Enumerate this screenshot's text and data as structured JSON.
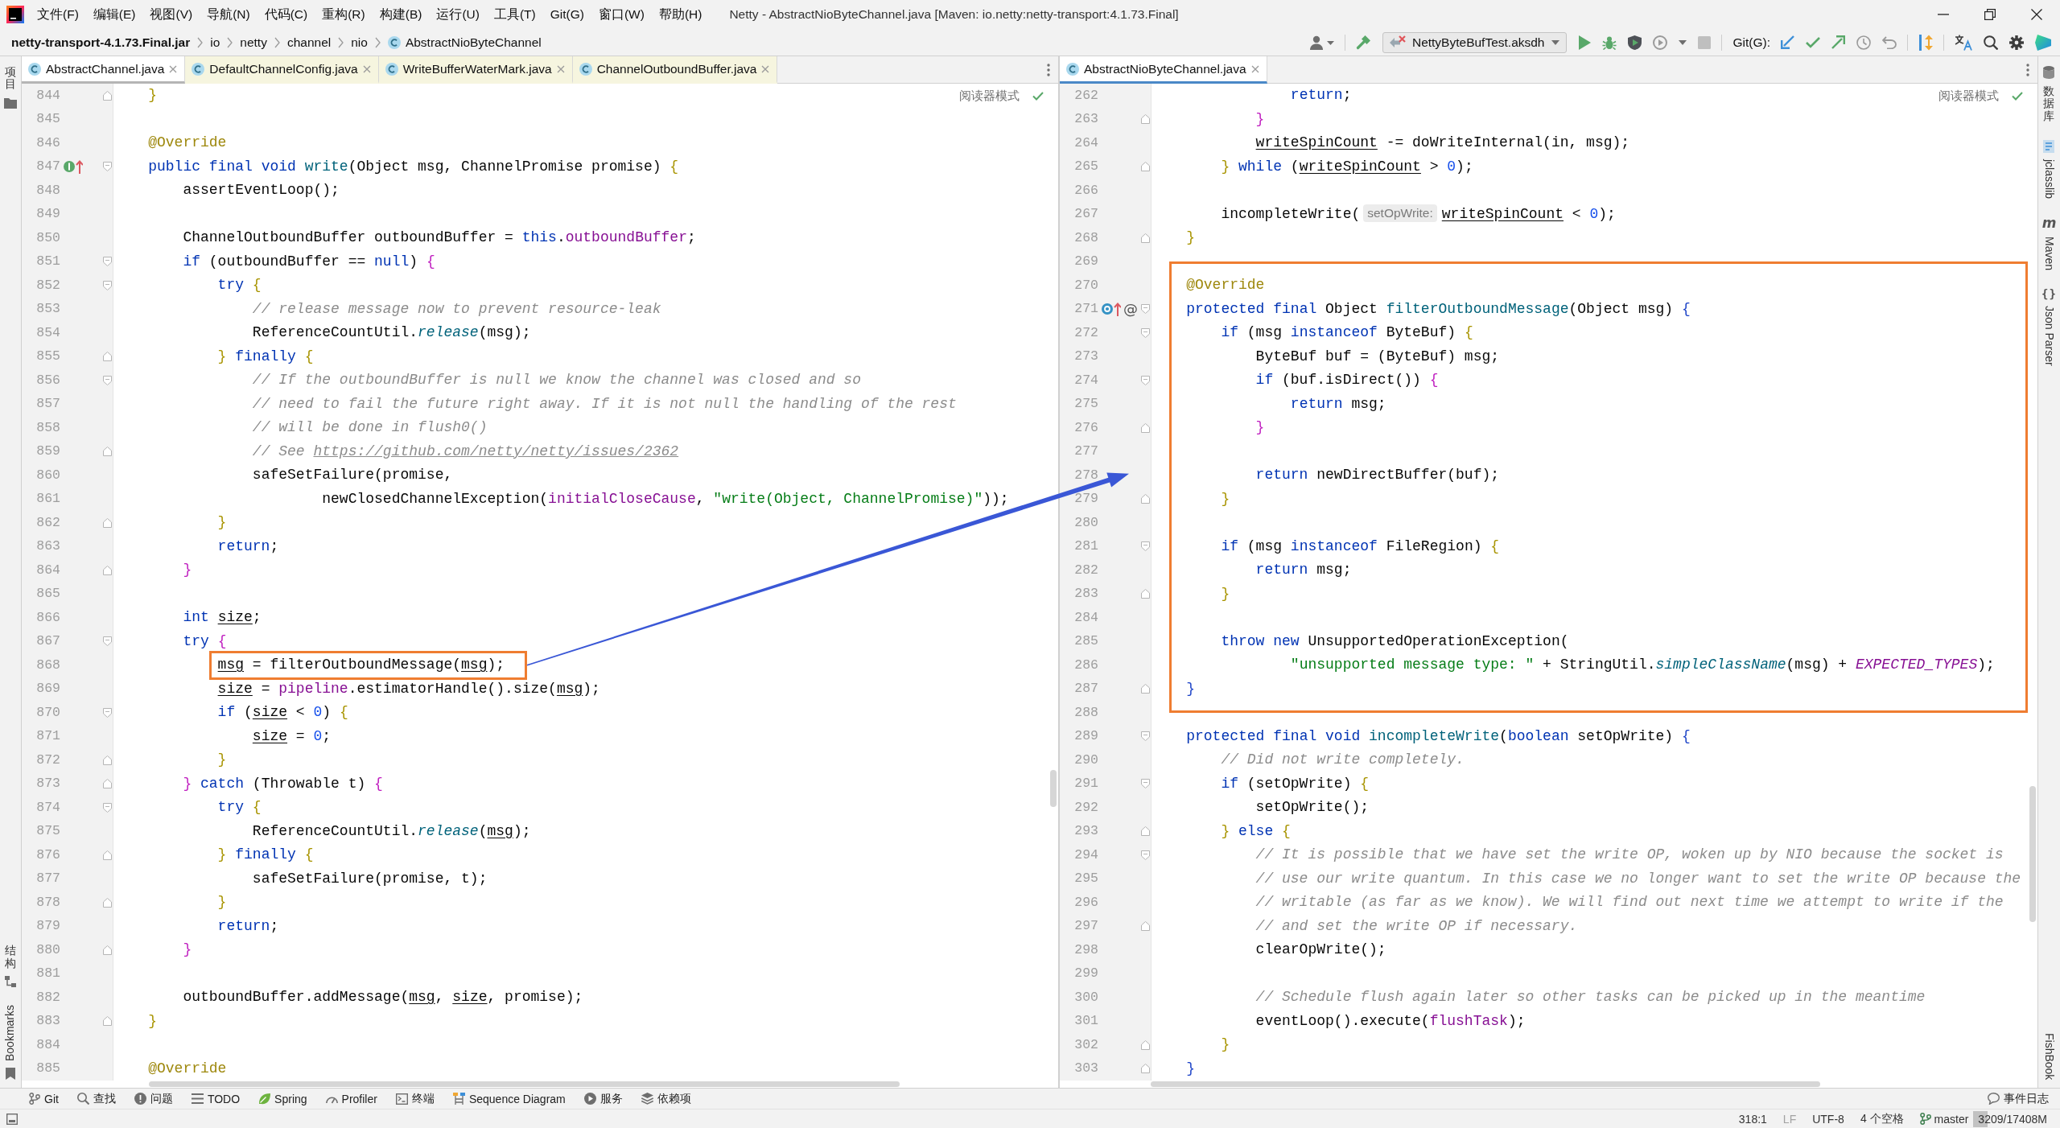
{
  "window": {
    "title": "Netty - AbstractNioByteChannel.java [Maven: io.netty:netty-transport:4.1.73.Final]"
  },
  "menu": [
    "文件(F)",
    "编辑(E)",
    "视图(V)",
    "导航(N)",
    "代码(C)",
    "重构(R)",
    "构建(B)",
    "运行(U)",
    "工具(T)",
    "Git(G)",
    "窗口(W)",
    "帮助(H)"
  ],
  "breadcrumbs": [
    {
      "label": "netty-transport-4.1.73.Final.jar",
      "kind": "archive"
    },
    {
      "label": "io",
      "kind": "package"
    },
    {
      "label": "netty",
      "kind": "package"
    },
    {
      "label": "channel",
      "kind": "package"
    },
    {
      "label": "nio",
      "kind": "package"
    },
    {
      "label": "AbstractNioByteChannel",
      "kind": "class"
    }
  ],
  "toolbar": [
    {
      "kind": "user",
      "disabled": false
    },
    {
      "kind": "build",
      "disabled": false
    },
    {
      "kind": "run-config",
      "label": "NettyByteBufTest.aksdh",
      "disabled": false
    },
    {
      "kind": "run",
      "disabled": false
    },
    {
      "kind": "debug",
      "disabled": false
    },
    {
      "kind": "coverage",
      "disabled": false
    },
    {
      "kind": "profile",
      "disabled": false
    },
    {
      "kind": "more",
      "disabled": false
    },
    {
      "kind": "stop",
      "disabled": true
    },
    {
      "kind": "label",
      "label": "Git(G):"
    },
    {
      "kind": "update",
      "disabled": false
    },
    {
      "kind": "commit",
      "disabled": false
    },
    {
      "kind": "push",
      "disabled": false
    },
    {
      "kind": "history",
      "disabled": false
    },
    {
      "kind": "rollback",
      "disabled": false
    },
    {
      "kind": "vcs",
      "disabled": false
    },
    {
      "kind": "translate",
      "disabled": false
    },
    {
      "kind": "search",
      "disabled": false
    },
    {
      "kind": "settings",
      "disabled": false
    },
    {
      "kind": "toolbox",
      "disabled": false
    }
  ],
  "left_strip": {
    "top": [
      {
        "label": "项目",
        "kind": "project"
      }
    ],
    "bottom": [
      {
        "label": "结构",
        "kind": "structure"
      },
      {
        "label": "Bookmarks",
        "kind": "bookmarks"
      }
    ]
  },
  "editors": [
    {
      "focused": false,
      "reader_mode": "阅读器模式",
      "tabs": [
        {
          "label": "AbstractChannel.java",
          "selected": true
        },
        {
          "label": "DefaultChannelConfig.java",
          "selected": false
        },
        {
          "label": "WriteBufferWaterMark.java",
          "selected": false
        },
        {
          "label": "ChannelOutboundBuffer.java",
          "selected": false
        }
      ],
      "blocks": [
        {
          "highlighted": false,
          "lines": [
            {
              "number": "844",
              "fold": {
                "kind": "end"
              },
              "code": [
                {
                  "text": "    }",
                  "kind": "b1"
                }
              ]
            },
            {
              "number": "845"
            },
            {
              "number": "846",
              "code": [
                {
                  "text": "    @Override",
                  "kind": "ann"
                }
              ]
            },
            {
              "number": "847",
              "fold": {
                "kind": "start"
              },
              "gutter": [
                {
                  "kind": "implements"
                }
              ],
              "code": [
                {
                  "text": "    public final void ",
                  "kind": "kw"
                },
                {
                  "text": "write",
                  "kind": "fn"
                },
                {
                  "text": "(Object msg, ChannelPromise promise) ",
                  "kind": "p"
                },
                {
                  "text": "{",
                  "kind": "b1"
                }
              ]
            },
            {
              "number": "848",
              "code": [
                {
                  "text": "        assertEventLoop();",
                  "kind": "p"
                }
              ]
            },
            {
              "number": "849"
            },
            {
              "number": "850",
              "code": [
                {
                  "text": "        ChannelOutboundBuffer outboundBuffer = ",
                  "kind": "p"
                },
                {
                  "text": "this",
                  "kind": "kw"
                },
                {
                  "text": ".",
                  "kind": "p"
                },
                {
                  "text": "outboundBuffer",
                  "kind": "field"
                },
                {
                  "text": ";",
                  "kind": "p"
                }
              ]
            },
            {
              "number": "851",
              "fold": {
                "kind": "start"
              },
              "code": [
                {
                  "text": "        if ",
                  "kind": "kw"
                },
                {
                  "text": "(outboundBuffer == ",
                  "kind": "p"
                },
                {
                  "text": "null",
                  "kind": "kw"
                },
                {
                  "text": ") ",
                  "kind": "p"
                },
                {
                  "text": "{",
                  "kind": "b2"
                }
              ]
            },
            {
              "number": "852",
              "fold": {
                "kind": "start"
              },
              "code": [
                {
                  "text": "            try ",
                  "kind": "kw"
                },
                {
                  "text": "{",
                  "kind": "b1"
                }
              ]
            },
            {
              "number": "853",
              "code": [
                {
                  "text": "                // release message now to prevent resource-leak",
                  "kind": "com"
                }
              ]
            },
            {
              "number": "854",
              "code": [
                {
                  "text": "                ReferenceCountUtil.",
                  "kind": "p"
                },
                {
                  "text": "release",
                  "kind": "static"
                },
                {
                  "text": "(msg);",
                  "kind": "p"
                }
              ]
            },
            {
              "number": "855",
              "fold": {
                "kind": "end"
              },
              "code": [
                {
                  "text": "            }",
                  "kind": "b1"
                },
                {
                  "text": " finally ",
                  "kind": "kw"
                },
                {
                  "text": "{",
                  "kind": "b1"
                }
              ]
            },
            {
              "number": "856",
              "fold": {
                "kind": "start"
              },
              "code": [
                {
                  "text": "                // If the outboundBuffer is null we know the channel was closed and so",
                  "kind": "com"
                }
              ]
            },
            {
              "number": "857",
              "code": [
                {
                  "text": "                // need to fail the future right away. If it is not null the handling of the rest",
                  "kind": "com"
                }
              ]
            },
            {
              "number": "858",
              "code": [
                {
                  "text": "                // will be done in flush0()",
                  "kind": "com"
                }
              ]
            },
            {
              "number": "859",
              "fold": {
                "kind": "end"
              },
              "code": [
                {
                  "text": "                // See ",
                  "kind": "com"
                },
                {
                  "text": "https://github.com/netty/netty/issues/2362",
                  "kind": "link"
                }
              ]
            },
            {
              "number": "860",
              "code": [
                {
                  "text": "                safeSetFailure(promise,",
                  "kind": "p"
                }
              ]
            },
            {
              "number": "861",
              "code": [
                {
                  "text": "                        newClosedChannelException(",
                  "kind": "p"
                },
                {
                  "text": "initialCloseCause",
                  "kind": "field"
                },
                {
                  "text": ", ",
                  "kind": "p"
                },
                {
                  "text": "\"write(Object, ChannelPromise)\"",
                  "kind": "str"
                },
                {
                  "text": "));",
                  "kind": "p"
                }
              ]
            },
            {
              "number": "862",
              "fold": {
                "kind": "end"
              },
              "code": [
                {
                  "text": "            }",
                  "kind": "b1"
                }
              ]
            },
            {
              "number": "863",
              "code": [
                {
                  "text": "            return",
                  "kind": "kw"
                },
                {
                  "text": ";",
                  "kind": "p"
                }
              ]
            },
            {
              "number": "864",
              "fold": {
                "kind": "end"
              },
              "code": [
                {
                  "text": "        }",
                  "kind": "b2"
                }
              ]
            },
            {
              "number": "865"
            },
            {
              "number": "866",
              "code": [
                {
                  "text": "        int ",
                  "kind": "kw"
                },
                {
                  "text": "size",
                  "kind": "var"
                },
                {
                  "text": ";",
                  "kind": "p"
                }
              ]
            },
            {
              "number": "867",
              "fold": {
                "kind": "start"
              },
              "code": [
                {
                  "text": "        try ",
                  "kind": "kw"
                },
                {
                  "text": "{",
                  "kind": "b2"
                }
              ]
            }
          ]
        },
        {
          "highlighted": true,
          "lines": [
            {
              "number": "868",
              "code": [
                {
                  "text": "            msg",
                  "kind": "var"
                },
                {
                  "text": " = filterOutboundMessage(",
                  "kind": "p"
                },
                {
                  "text": "msg",
                  "kind": "var"
                },
                {
                  "text": ");",
                  "kind": "p"
                }
              ]
            }
          ]
        },
        {
          "highlighted": false,
          "lines": [
            {
              "number": "869",
              "code": [
                {
                  "text": "            size",
                  "kind": "var"
                },
                {
                  "text": " = ",
                  "kind": "p"
                },
                {
                  "text": "pipeline",
                  "kind": "field"
                },
                {
                  "text": ".estimatorHandle().size(",
                  "kind": "p"
                },
                {
                  "text": "msg",
                  "kind": "var"
                },
                {
                  "text": ");",
                  "kind": "p"
                }
              ]
            },
            {
              "number": "870",
              "fold": {
                "kind": "start"
              },
              "code": [
                {
                  "text": "            if ",
                  "kind": "kw"
                },
                {
                  "text": "(",
                  "kind": "p"
                },
                {
                  "text": "size",
                  "kind": "var"
                },
                {
                  "text": " < ",
                  "kind": "p"
                },
                {
                  "text": "0",
                  "kind": "num"
                },
                {
                  "text": ") ",
                  "kind": "p"
                },
                {
                  "text": "{",
                  "kind": "b1"
                }
              ]
            },
            {
              "number": "871",
              "code": [
                {
                  "text": "                size",
                  "kind": "var"
                },
                {
                  "text": " = ",
                  "kind": "p"
                },
                {
                  "text": "0",
                  "kind": "num"
                },
                {
                  "text": ";",
                  "kind": "p"
                }
              ]
            },
            {
              "number": "872",
              "fold": {
                "kind": "end"
              },
              "code": [
                {
                  "text": "            }",
                  "kind": "b1"
                }
              ]
            },
            {
              "number": "873",
              "fold": {
                "kind": "end"
              },
              "code": [
                {
                  "text": "        }",
                  "kind": "b2"
                },
                {
                  "text": " catch ",
                  "kind": "kw"
                },
                {
                  "text": "(Throwable t) ",
                  "kind": "p"
                },
                {
                  "text": "{",
                  "kind": "b2"
                }
              ]
            },
            {
              "number": "874",
              "fold": {
                "kind": "start"
              },
              "code": [
                {
                  "text": "            try ",
                  "kind": "kw"
                },
                {
                  "text": "{",
                  "kind": "b1"
                }
              ]
            },
            {
              "number": "875",
              "code": [
                {
                  "text": "                ReferenceCountUtil.",
                  "kind": "p"
                },
                {
                  "text": "release",
                  "kind": "static"
                },
                {
                  "text": "(",
                  "kind": "p"
                },
                {
                  "text": "msg",
                  "kind": "var"
                },
                {
                  "text": ");",
                  "kind": "p"
                }
              ]
            },
            {
              "number": "876",
              "fold": {
                "kind": "end"
              },
              "code": [
                {
                  "text": "            }",
                  "kind": "b1"
                },
                {
                  "text": " finally ",
                  "kind": "kw"
                },
                {
                  "text": "{",
                  "kind": "b1"
                }
              ]
            },
            {
              "number": "877",
              "code": [
                {
                  "text": "                safeSetFailure(promise, t);",
                  "kind": "p"
                }
              ]
            },
            {
              "number": "878",
              "fold": {
                "kind": "end"
              },
              "code": [
                {
                  "text": "            }",
                  "kind": "b1"
                }
              ]
            },
            {
              "number": "879",
              "code": [
                {
                  "text": "            return",
                  "kind": "kw"
                },
                {
                  "text": ";",
                  "kind": "p"
                }
              ]
            },
            {
              "number": "880",
              "fold": {
                "kind": "end"
              },
              "code": [
                {
                  "text": "        }",
                  "kind": "b2"
                }
              ]
            },
            {
              "number": "881"
            },
            {
              "number": "882",
              "code": [
                {
                  "text": "        outboundBuffer.addMessage(",
                  "kind": "p"
                },
                {
                  "text": "msg",
                  "kind": "var"
                },
                {
                  "text": ", ",
                  "kind": "p"
                },
                {
                  "text": "size",
                  "kind": "var"
                },
                {
                  "text": ", promise);",
                  "kind": "p"
                }
              ]
            },
            {
              "number": "883",
              "fold": {
                "kind": "end"
              },
              "code": [
                {
                  "text": "    }",
                  "kind": "b1"
                }
              ]
            },
            {
              "number": "884"
            },
            {
              "number": "885",
              "code": [
                {
                  "text": "    @Override",
                  "kind": "ann"
                }
              ]
            }
          ]
        }
      ]
    },
    {
      "focused": true,
      "reader_mode": "阅读器模式",
      "tabs": [
        {
          "label": "AbstractNioByteChannel.java",
          "selected": true
        }
      ],
      "blocks": [
        {
          "highlighted": false,
          "lines": [
            {
              "number": "262",
              "code": [
                {
                  "text": "                return",
                  "kind": "kw"
                },
                {
                  "text": ";",
                  "kind": "p"
                }
              ]
            },
            {
              "number": "263",
              "fold": {
                "kind": "end"
              },
              "code": [
                {
                  "text": "            }",
                  "kind": "b2"
                }
              ]
            },
            {
              "number": "264",
              "code": [
                {
                  "text": "            writeSpinCount",
                  "kind": "var"
                },
                {
                  "text": " -= doWriteInternal(in, msg);",
                  "kind": "p"
                }
              ]
            },
            {
              "number": "265",
              "fold": {
                "kind": "end"
              },
              "code": [
                {
                  "text": "        }",
                  "kind": "b1"
                },
                {
                  "text": " while ",
                  "kind": "kw"
                },
                {
                  "text": "(",
                  "kind": "p"
                },
                {
                  "text": "writeSpinCount",
                  "kind": "var"
                },
                {
                  "text": " > ",
                  "kind": "p"
                },
                {
                  "text": "0",
                  "kind": "num"
                },
                {
                  "text": ");",
                  "kind": "p"
                }
              ]
            },
            {
              "number": "266"
            },
            {
              "number": "267",
              "code": [
                {
                  "text": "        incompleteWrite(",
                  "kind": "p"
                },
                {
                  "text": "setOpWrite:",
                  "kind": "hint"
                },
                {
                  "text": "writeSpinCount",
                  "kind": "var"
                },
                {
                  "text": " < ",
                  "kind": "p"
                },
                {
                  "text": "0",
                  "kind": "num"
                },
                {
                  "text": ");",
                  "kind": "p"
                }
              ]
            },
            {
              "number": "268",
              "fold": {
                "kind": "end"
              },
              "code": [
                {
                  "text": "    }",
                  "kind": "b1"
                }
              ]
            },
            {
              "number": "269"
            }
          ]
        },
        {
          "highlighted": true,
          "lines": [
            {
              "number": "270",
              "code": [
                {
                  "text": "    @Override",
                  "kind": "ann"
                }
              ]
            },
            {
              "number": "271",
              "fold": {
                "kind": "start"
              },
              "gutter": [
                {
                  "kind": "overrides"
                },
                {
                  "kind": "annotation",
                  "glyph": "@"
                }
              ],
              "code": [
                {
                  "text": "    protected final ",
                  "kind": "kw"
                },
                {
                  "text": "Object ",
                  "kind": "p"
                },
                {
                  "text": "filterOutboundMessage",
                  "kind": "fn"
                },
                {
                  "text": "(Object msg) ",
                  "kind": "p"
                },
                {
                  "text": "{",
                  "kind": "b3"
                }
              ]
            },
            {
              "number": "272",
              "fold": {
                "kind": "start"
              },
              "code": [
                {
                  "text": "        if ",
                  "kind": "kw"
                },
                {
                  "text": "(msg ",
                  "kind": "p"
                },
                {
                  "text": "instanceof",
                  "kind": "kw"
                },
                {
                  "text": " ByteBuf) ",
                  "kind": "p"
                },
                {
                  "text": "{",
                  "kind": "b1"
                }
              ]
            },
            {
              "number": "273",
              "code": [
                {
                  "text": "            ByteBuf buf = (ByteBuf) msg;",
                  "kind": "p"
                }
              ]
            },
            {
              "number": "274",
              "fold": {
                "kind": "start"
              },
              "code": [
                {
                  "text": "            if ",
                  "kind": "kw"
                },
                {
                  "text": "(buf.isDirect()) ",
                  "kind": "p"
                },
                {
                  "text": "{",
                  "kind": "b2"
                }
              ]
            },
            {
              "number": "275",
              "code": [
                {
                  "text": "                return",
                  "kind": "kw"
                },
                {
                  "text": " msg;",
                  "kind": "p"
                }
              ]
            },
            {
              "number": "276",
              "fold": {
                "kind": "end"
              },
              "code": [
                {
                  "text": "            }",
                  "kind": "b2"
                }
              ]
            },
            {
              "number": "277"
            },
            {
              "number": "278",
              "code": [
                {
                  "text": "            return",
                  "kind": "kw"
                },
                {
                  "text": " newDirectBuffer(buf);",
                  "kind": "p"
                }
              ]
            },
            {
              "number": "279",
              "fold": {
                "kind": "end"
              },
              "code": [
                {
                  "text": "        }",
                  "kind": "b1"
                }
              ]
            },
            {
              "number": "280"
            },
            {
              "number": "281",
              "fold": {
                "kind": "start"
              },
              "code": [
                {
                  "text": "        if ",
                  "kind": "kw"
                },
                {
                  "text": "(msg ",
                  "kind": "p"
                },
                {
                  "text": "instanceof",
                  "kind": "kw"
                },
                {
                  "text": " FileRegion) ",
                  "kind": "p"
                },
                {
                  "text": "{",
                  "kind": "b1"
                }
              ]
            },
            {
              "number": "282",
              "code": [
                {
                  "text": "            return",
                  "kind": "kw"
                },
                {
                  "text": " msg;",
                  "kind": "p"
                }
              ]
            },
            {
              "number": "283",
              "fold": {
                "kind": "end"
              },
              "code": [
                {
                  "text": "        }",
                  "kind": "b1"
                }
              ]
            },
            {
              "number": "284"
            },
            {
              "number": "285",
              "code": [
                {
                  "text": "        throw new ",
                  "kind": "kw"
                },
                {
                  "text": "UnsupportedOperationException(",
                  "kind": "p"
                }
              ]
            },
            {
              "number": "286",
              "code": [
                {
                  "text": "                \"unsupported message type: \"",
                  "kind": "str"
                },
                {
                  "text": " + StringUtil.",
                  "kind": "p"
                },
                {
                  "text": "simpleClassName",
                  "kind": "static"
                },
                {
                  "text": "(msg) + ",
                  "kind": "p"
                },
                {
                  "text": "EXPECTED_TYPES",
                  "kind": "const"
                },
                {
                  "text": ");",
                  "kind": "p"
                }
              ]
            },
            {
              "number": "287",
              "fold": {
                "kind": "end"
              },
              "code": [
                {
                  "text": "    }",
                  "kind": "b3"
                }
              ]
            }
          ]
        },
        {
          "highlighted": false,
          "lines": [
            {
              "number": "288"
            },
            {
              "number": "289",
              "fold": {
                "kind": "start"
              },
              "code": [
                {
                  "text": "    protected final void ",
                  "kind": "kw"
                },
                {
                  "text": "incompleteWrite",
                  "kind": "fn"
                },
                {
                  "text": "(",
                  "kind": "p"
                },
                {
                  "text": "boolean",
                  "kind": "kw"
                },
                {
                  "text": " setOpWrite) ",
                  "kind": "p"
                },
                {
                  "text": "{",
                  "kind": "b3"
                }
              ]
            },
            {
              "number": "290",
              "code": [
                {
                  "text": "        // Did not write completely.",
                  "kind": "com"
                }
              ]
            },
            {
              "number": "291",
              "fold": {
                "kind": "start"
              },
              "code": [
                {
                  "text": "        if ",
                  "kind": "kw"
                },
                {
                  "text": "(setOpWrite) ",
                  "kind": "p"
                },
                {
                  "text": "{",
                  "kind": "b1"
                }
              ]
            },
            {
              "number": "292",
              "code": [
                {
                  "text": "            setOpWrite();",
                  "kind": "p"
                }
              ]
            },
            {
              "number": "293",
              "fold": {
                "kind": "end"
              },
              "code": [
                {
                  "text": "        }",
                  "kind": "b1"
                },
                {
                  "text": " else ",
                  "kind": "kw"
                },
                {
                  "text": "{",
                  "kind": "b1"
                }
              ]
            },
            {
              "number": "294",
              "fold": {
                "kind": "start"
              },
              "code": [
                {
                  "text": "            // It is possible that we have set the write OP, woken up by NIO because the socket is",
                  "kind": "com"
                }
              ]
            },
            {
              "number": "295",
              "code": [
                {
                  "text": "            // use our write quantum. In this case we no longer want to set the write OP because the",
                  "kind": "com"
                }
              ]
            },
            {
              "number": "296",
              "code": [
                {
                  "text": "            // writable (as far as we know). We will find out next time we attempt to write if the",
                  "kind": "com"
                }
              ]
            },
            {
              "number": "297",
              "fold": {
                "kind": "end"
              },
              "code": [
                {
                  "text": "            // and set the write OP if necessary.",
                  "kind": "com"
                }
              ]
            },
            {
              "number": "298",
              "code": [
                {
                  "text": "            clearOpWrite();",
                  "kind": "p"
                }
              ]
            },
            {
              "number": "299"
            },
            {
              "number": "300",
              "code": [
                {
                  "text": "            // Schedule flush again later so other tasks can be picked up in the meantime",
                  "kind": "com"
                }
              ]
            },
            {
              "number": "301",
              "code": [
                {
                  "text": "            eventLoop().execute(",
                  "kind": "p"
                },
                {
                  "text": "flushTask",
                  "kind": "field"
                },
                {
                  "text": ");",
                  "kind": "p"
                }
              ]
            },
            {
              "number": "302",
              "fold": {
                "kind": "end"
              },
              "code": [
                {
                  "text": "        }",
                  "kind": "b1"
                }
              ]
            },
            {
              "number": "303",
              "fold": {
                "kind": "end"
              },
              "code": [
                {
                  "text": "    }",
                  "kind": "b3"
                }
              ]
            }
          ]
        }
      ]
    }
  ],
  "right_strip": {
    "top": [
      {
        "label": "数据库",
        "kind": "database"
      },
      {
        "label": "jclasslib",
        "kind": "jclasslib"
      },
      {
        "label": "Maven",
        "kind": "maven",
        "glyph": "m"
      },
      {
        "label": "Json Parser",
        "kind": "json",
        "glyph": "{}"
      }
    ],
    "bottom": [
      {
        "label": "FishBook"
      }
    ]
  },
  "tool_window_bar": {
    "left": [
      {
        "label": "Git",
        "kind": "git"
      },
      {
        "label": "查找",
        "kind": "find"
      },
      {
        "label": "问题",
        "kind": "problems"
      },
      {
        "label": "TODO",
        "kind": "todo"
      },
      {
        "label": "Spring",
        "kind": "spring"
      },
      {
        "label": "Profiler",
        "kind": "profiler"
      },
      {
        "label": "终端",
        "kind": "terminal"
      },
      {
        "label": "Sequence Diagram",
        "kind": "sequence"
      },
      {
        "label": "服务",
        "kind": "services"
      },
      {
        "label": "依赖项",
        "kind": "dependencies"
      }
    ],
    "right": [
      {
        "label": "事件日志",
        "kind": "event-log"
      }
    ]
  },
  "status_bar": {
    "items": [
      {
        "kind": "text",
        "label": "318:1",
        "disabled": false
      },
      {
        "kind": "text",
        "label": "LF",
        "disabled": true
      },
      {
        "kind": "text",
        "label": "UTF-8",
        "disabled": false
      },
      {
        "kind": "text",
        "label": "4 个空格",
        "disabled": false
      },
      {
        "kind": "branch",
        "label": "master"
      },
      {
        "kind": "memory",
        "label": "3209/17408M",
        "level": 0.18
      }
    ]
  }
}
